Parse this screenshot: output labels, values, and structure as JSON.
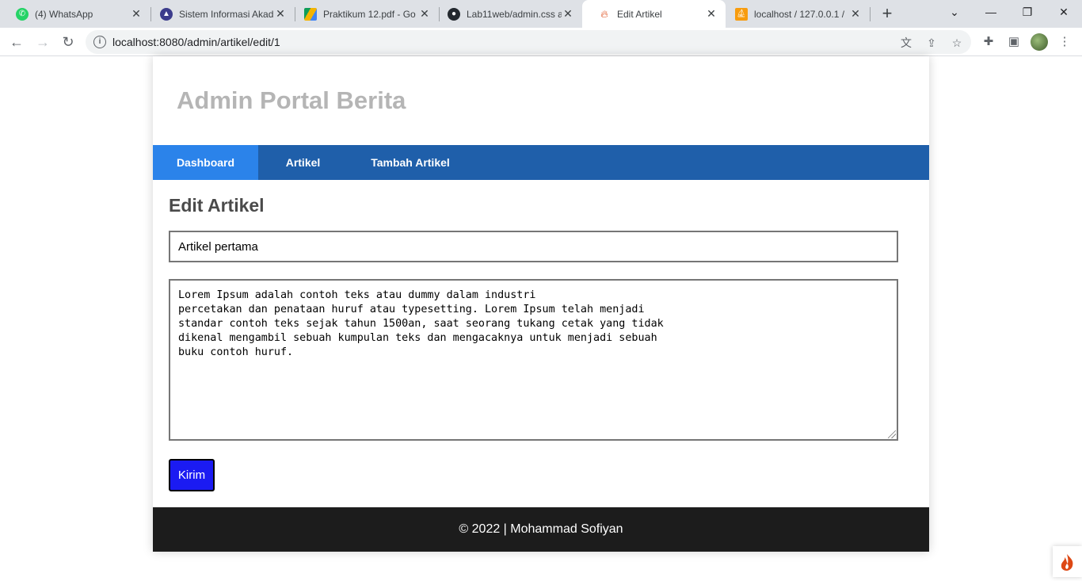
{
  "browser": {
    "tabs": [
      {
        "title": "(4) WhatsApp",
        "icon": "whatsapp-icon",
        "color": "#25d366"
      },
      {
        "title": "Sistem Informasi Akad",
        "icon": "university-icon",
        "color": "#3c3c8c"
      },
      {
        "title": "Praktikum 12.pdf - Go",
        "icon": "google-drive-icon",
        "color": "#f4b400"
      },
      {
        "title": "Lab11web/admin.css a",
        "icon": "github-icon",
        "color": "#24292f"
      },
      {
        "title": "Edit Artikel",
        "icon": "codeigniter-icon",
        "color": "#dd4814"
      },
      {
        "title": "localhost / 127.0.0.1 /",
        "icon": "phpmyadmin-icon",
        "color": "#f89c0e"
      }
    ],
    "active_tab": 4,
    "url": "localhost:8080/admin/artikel/edit/1"
  },
  "site": {
    "title": "Admin Portal Berita",
    "nav": [
      {
        "label": "Dashboard",
        "active": true
      },
      {
        "label": "Artikel",
        "active": false
      },
      {
        "label": "Tambah Artikel",
        "active": false
      }
    ]
  },
  "form": {
    "heading": "Edit Artikel",
    "title_value": "Artikel pertama",
    "body_value": "Lorem Ipsum adalah contoh teks atau dummy dalam industri\npercetakan dan penataan huruf atau typesetting. Lorem Ipsum telah menjadi\nstandar contoh teks sejak tahun 1500an, saat seorang tukang cetak yang tidak\ndikenal mengambil sebuah kumpulan teks dan mengacaknya untuk menjadi sebuah\nbuku contoh huruf.",
    "submit_label": "Kirim"
  },
  "footer": {
    "text": "© 2022 | Mohammad Sofiyan"
  },
  "colors": {
    "nav_bg": "#1f5faa",
    "nav_active": "#2b83ea",
    "submit_bg": "#1b1bf2",
    "footer_bg": "#1c1c1c",
    "header_text": "#b5b5b5"
  }
}
